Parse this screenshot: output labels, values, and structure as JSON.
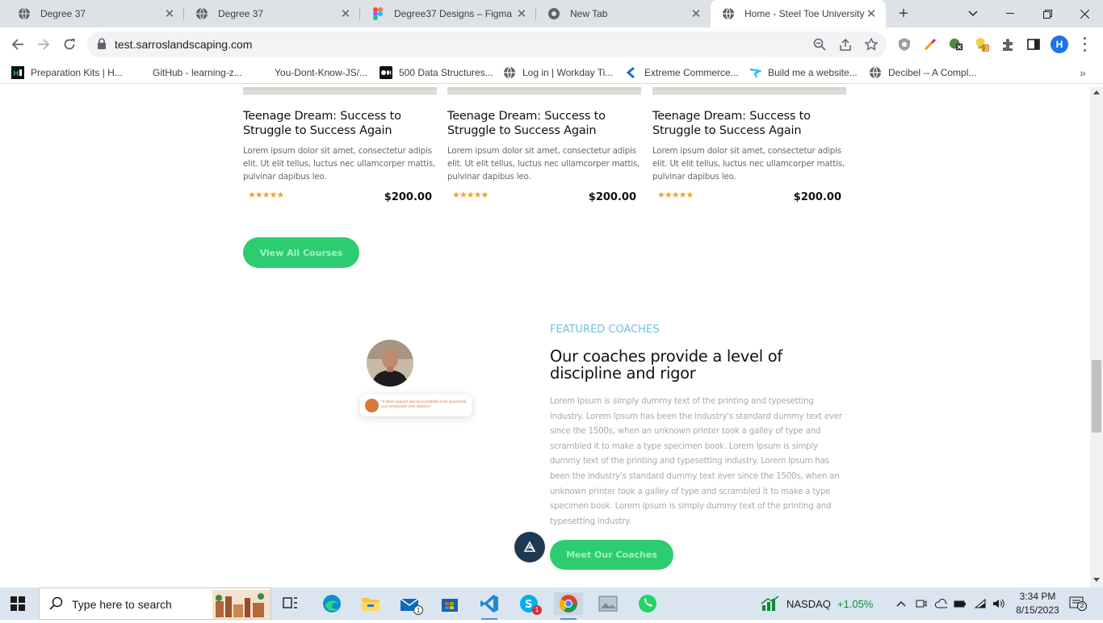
{
  "browser": {
    "tabs": [
      {
        "label": "Degree 37",
        "icon": "globe-icon"
      },
      {
        "label": "Degree 37",
        "icon": "globe-icon"
      },
      {
        "label": "Degree37 Designs – Figma",
        "icon": "figma-icon"
      },
      {
        "label": "New Tab",
        "icon": "chrome-icon"
      },
      {
        "label": "Home - Steel Toe University",
        "icon": "globe-icon",
        "active": true
      }
    ],
    "url": "test.sarroslandscaping.com",
    "profile_initial": "H",
    "extension_badge": "3",
    "bookmarks": [
      {
        "label": "Preparation Kits | H...",
        "icon": "hackerrank-icon"
      },
      {
        "label": "GitHub - learning-z...",
        "icon": "github-icon"
      },
      {
        "label": "You-Dont-Know-JS/...",
        "icon": "github-icon"
      },
      {
        "label": "500 Data Structures...",
        "icon": "medium-icon"
      },
      {
        "label": "Log in | Workday Ti...",
        "icon": "globe-icon"
      },
      {
        "label": "Extreme Commerce...",
        "icon": "ec-icon"
      },
      {
        "label": "Build me a website...",
        "icon": "fiverr-icon"
      },
      {
        "label": "Decibel -- A Compl...",
        "icon": "globe-icon"
      }
    ]
  },
  "courses": [
    {
      "title": "Teenage Dream: Success to Struggle to Success Again",
      "description": "Lorem ipsum dolor sit amet, consectetur adipis elit. Ut elit tellus, luctus nec ullamcorper mattis, pulvinar dapibus leo.",
      "stars": "★★★★★",
      "price": "$200.00"
    },
    {
      "title": "Teenage Dream: Success to Struggle to Success Again",
      "description": "Lorem ipsum dolor sit amet, consectetur adipis elit. Ut elit tellus, luctus nec ullamcorper mattis, pulvinar dapibus leo.",
      "stars": "★★★★★",
      "price": "$200.00"
    },
    {
      "title": "Teenage Dream: Success to Struggle to Success Again",
      "description": "Lorem ipsum dolor sit amet, consectetur adipis elit. Ut elit tellus, luctus nec ullamcorper mattis, pulvinar dapibus leo.",
      "stars": "★★★★★",
      "price": "$200.00"
    }
  ],
  "view_all_label": "View All Courses",
  "featured": {
    "label": "FEATURED COACHES",
    "title": "Our coaches provide a level of discipline and rigor",
    "body": "Lorem Ipsum is simply dummy text of the printing and typesetting industry. Lorem Ipsum has been the industry's standard dummy text ever since the 1500s, when an unknown printer took a galley of type and scrambled it to make a type specimen book. Lorem Ipsum is simply dummy text of the printing and typesetting industry. Lorem Ipsum has been the industry's standard dummy text ever since the 1500s, when an unknown printer took a galley of type and scrambled it to make a type specimen book. Lorem Ipsum is simply dummy text of the printing and typesetting industry.",
    "quote": "\"It takes support and accountability to be successful and CONQUER over delivers.\"",
    "button_label": "Meet Our Coaches"
  },
  "taskbar": {
    "search_placeholder": "Type here to search",
    "mail_badge": "1",
    "skype_badge": "1",
    "ticker_name": "NASDAQ",
    "ticker_change": "+1.05%",
    "time": "3:34 PM",
    "date": "8/15/2023",
    "notification_count": "2"
  },
  "colors": {
    "accent_green": "#2ecc71",
    "featured_blue": "#6ec1e4",
    "star_orange": "#e8a33d",
    "chat_button": "#1e3a52"
  }
}
